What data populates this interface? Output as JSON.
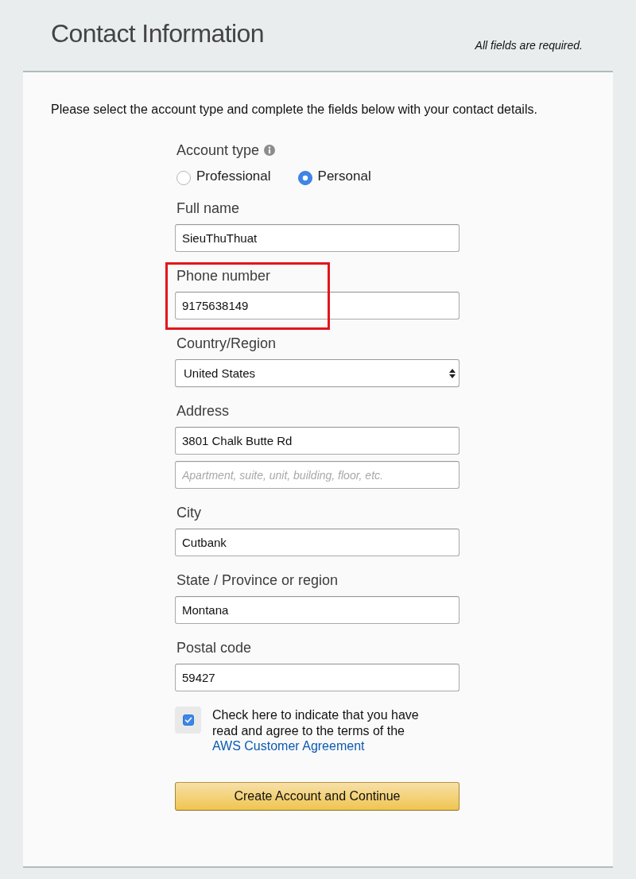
{
  "header": {
    "title": "Contact Information",
    "note": "All fields are required."
  },
  "intro": "Please select the account type and complete the fields below with your contact details.",
  "account_type": {
    "label": "Account type",
    "options": [
      {
        "label": "Professional",
        "selected": false
      },
      {
        "label": "Personal",
        "selected": true
      }
    ]
  },
  "fields": [
    {
      "kind": "text",
      "label": "Full name",
      "highlighted": false,
      "inputs": [
        {
          "value": "SieuThuThuat"
        }
      ]
    },
    {
      "kind": "text",
      "label": "Phone number",
      "highlighted": true,
      "inputs": [
        {
          "value": "9175638149"
        }
      ]
    },
    {
      "kind": "select",
      "label": "Country/Region",
      "highlighted": false,
      "inputs": [
        {
          "value": "United States"
        }
      ]
    },
    {
      "kind": "text",
      "label": "Address",
      "highlighted": false,
      "inputs": [
        {
          "value": "3801 Chalk Butte Rd"
        },
        {
          "placeholder": "Apartment, suite, unit, building, floor, etc."
        }
      ]
    },
    {
      "kind": "text",
      "label": "City",
      "highlighted": false,
      "inputs": [
        {
          "value": "Cutbank"
        }
      ]
    },
    {
      "kind": "text",
      "label": "State / Province or region",
      "highlighted": false,
      "inputs": [
        {
          "value": "Montana"
        }
      ]
    },
    {
      "kind": "text",
      "label": "Postal code",
      "highlighted": false,
      "inputs": [
        {
          "value": "59427"
        }
      ]
    }
  ],
  "agreement": {
    "checked": true,
    "text": "Check here to indicate that you have read and agree to the terms of the",
    "link": "AWS Customer Agreement"
  },
  "submit_button": "Create Account and Continue"
}
